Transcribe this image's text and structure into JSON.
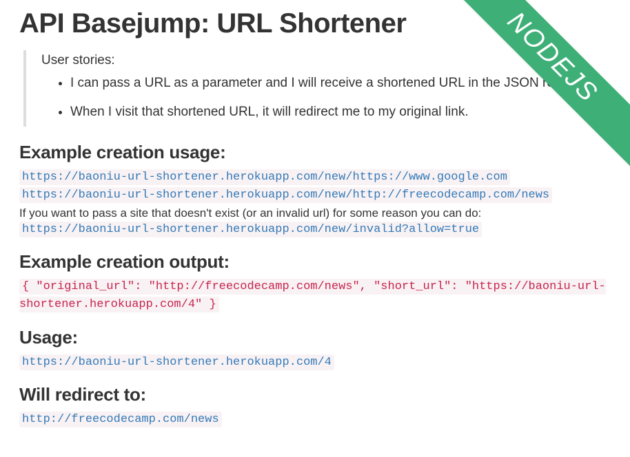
{
  "ribbon": "NODEJS",
  "title": "API Basejump: URL Shortener",
  "userStories": {
    "lead": "User stories:",
    "items": [
      "I can pass a URL as a parameter and I will receive a shortened URL in the JSON response.",
      "When I visit that shortened URL, it will redirect me to my original link."
    ]
  },
  "sections": {
    "creationUsage": {
      "heading": "Example creation usage:",
      "url1": "https://baoniu-url-shortener.herokuapp.com/new/https://www.google.com",
      "url2": "https://baoniu-url-shortener.herokuapp.com/new/http://freecodecamp.com/news",
      "note": "If you want to pass a site that doesn't exist (or an invalid url) for some reason you can do:",
      "url3": "https://baoniu-url-shortener.herokuapp.com/new/invalid?allow=true"
    },
    "creationOutput": {
      "heading": "Example creation output:",
      "code": "{ \"original_url\": \"http://freecodecamp.com/news\", \"short_url\": \"https://baoniu-url-shortener.herokuapp.com/4\" }"
    },
    "usage": {
      "heading": "Usage:",
      "url": "https://baoniu-url-shortener.herokuapp.com/4"
    },
    "redirect": {
      "heading": "Will redirect to:",
      "url": "http://freecodecamp.com/news"
    }
  }
}
